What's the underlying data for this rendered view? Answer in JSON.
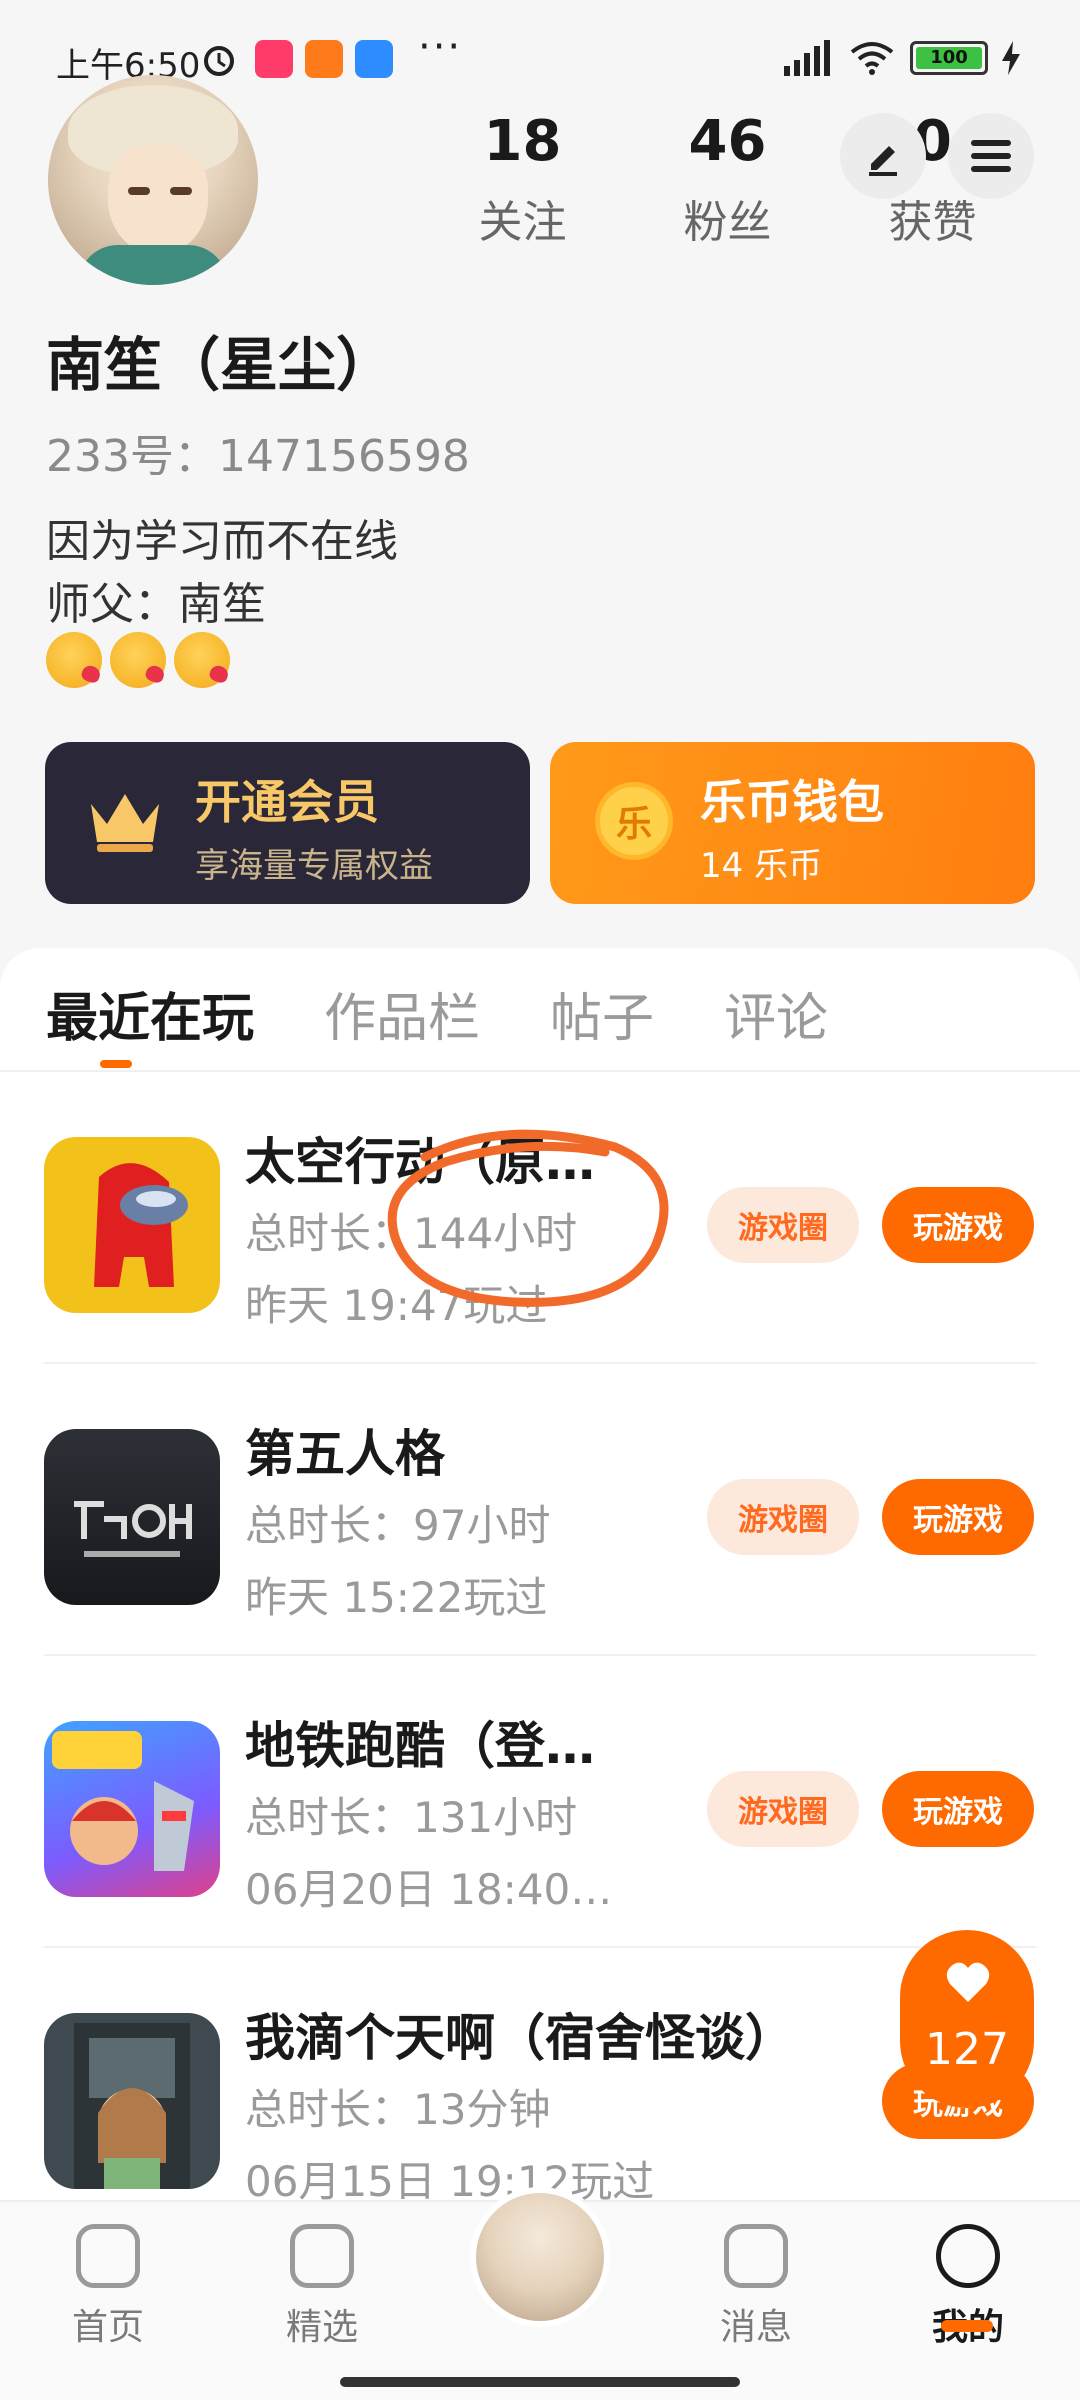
{
  "status_bar": {
    "time": "上午6:50",
    "battery": "100",
    "more": "···"
  },
  "profile": {
    "name": "南笙（星尘）",
    "uid_label": "233号：147156598",
    "bio_line1": "因为学习而不在线",
    "bio_line2": "师父：南笙",
    "stats": [
      {
        "value": "18",
        "label": "关注"
      },
      {
        "value": "46",
        "label": "粉丝"
      },
      {
        "value": "0",
        "label": "获赞"
      }
    ]
  },
  "cards": {
    "vip": {
      "title": "开通会员",
      "sub": "享海量专属权益"
    },
    "wallet": {
      "title": "乐币钱包",
      "sub": "14 乐币",
      "coin_glyph": "乐"
    }
  },
  "tabs": [
    "最近在玩",
    "作品栏",
    "帖子",
    "评论"
  ],
  "games": [
    {
      "title": "太空行动（原…",
      "duration": "总时长：144小时",
      "last": "昨天 19:47玩过",
      "btn_circle": "游戏圈",
      "btn_play": "玩游戏"
    },
    {
      "title": "第五人格",
      "duration": "总时长：97小时",
      "last": "昨天 15:22玩过",
      "btn_circle": "游戏圈",
      "btn_play": "玩游戏"
    },
    {
      "title": "地铁跑酷（登…",
      "duration": "总时长：131小时",
      "last": "06月20日 18:40…",
      "btn_circle": "游戏圈",
      "btn_play": "玩游戏"
    },
    {
      "title": "我滴个天啊（宿舍怪谈）",
      "duration": "总时长：13分钟",
      "last": "06月15日 19:12玩过",
      "btn_play": "玩游戏"
    }
  ],
  "floating_like": {
    "count": "127"
  },
  "bottom_nav": [
    {
      "label": "首页"
    },
    {
      "label": "精选"
    },
    {
      "label": "消息"
    },
    {
      "label": "我的"
    }
  ]
}
